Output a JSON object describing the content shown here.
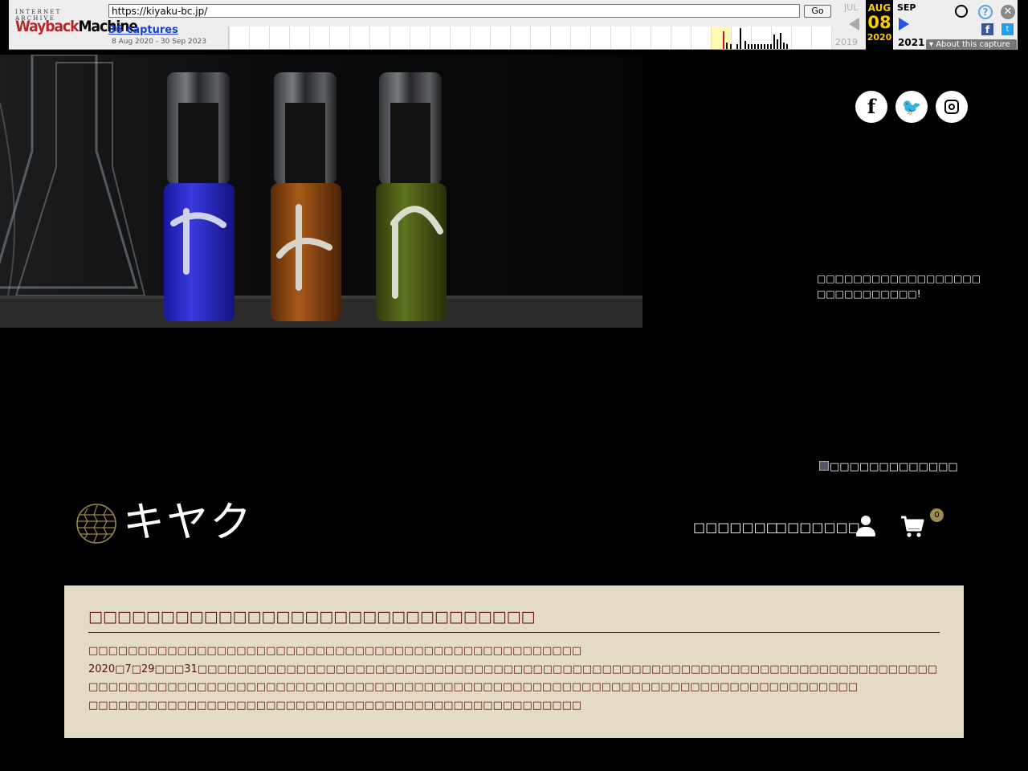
{
  "wayback": {
    "logo_top": "INTERNET ARCHIVE",
    "logo_main_a": "Wayback",
    "logo_main_b": "Machine",
    "url": "https://kiyaku-bc.jp/",
    "go_label": "Go",
    "captures": "36 captures",
    "date_range": "8 Aug 2020 - 30 Sep 2023",
    "prev_month": "JUL",
    "prev_year": "2019",
    "cur_month": "AUG",
    "cur_day": "08",
    "cur_year": "2020",
    "next_month": "SEP",
    "next_year": "2021",
    "about": "About this capture",
    "help_glyph": "?",
    "close_glyph": "✕",
    "fb_glyph": "f",
    "tw_glyph": "t"
  },
  "social": {
    "facebook_glyph": "f",
    "twitter_glyph": "🐦"
  },
  "side_text": {
    "line1": "□□□□□□□□□□□□□□□□□□",
    "line2": "□□□□□□□□□□□!"
  },
  "broken_image_alt": "□□□□□□□□□□□□□",
  "header": {
    "logo_text": "キヤク",
    "nav_1": "□□□□□□□",
    "nav_2": "□□□□□□□",
    "cart_count": "0"
  },
  "notice": {
    "title": "□□□□□□□□□□□□□□□□□□□□□□□□□□□□□□□",
    "lines": [
      "□□□□□□□□□□□□□□□□□□□□□□□□□□□□□□□□□□□□□□□□□□□□□□□□□□",
      "2020□7□29□□□31□□□□□□□□□□□□□□□□□□□□□□□□□□□□□□□□□□□□□□□□□□□□□□□□□□□□□□□□□□□□□□□□□□□□□□□□□□□",
      "□□□□□□□□□□□□□□□□□□□□□□□□□□□□□□□□□□□□□□□□□□□□□□□□□□□□□□□□□□□□□□□□□□□□□□□□□□□□□□",
      "□□□□□□□□□□□□□□□□□□□□□□□□□□□□□□□□□□□□□□□□□□□□□□□□□□"
    ]
  }
}
